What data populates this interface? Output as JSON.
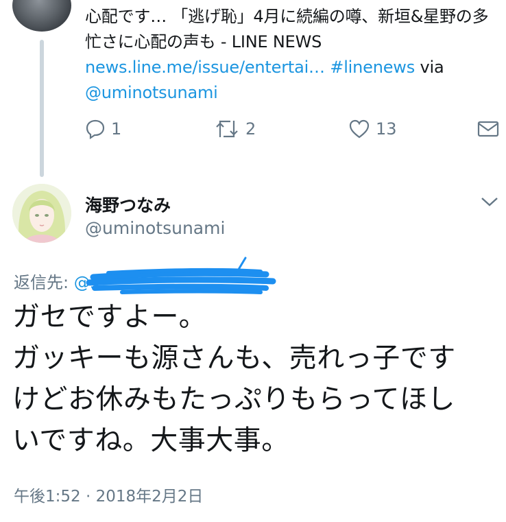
{
  "prev_tweet": {
    "text": "心配です… 「逃げ恥」4月に続編の噂、新垣&星野の多忙さに心配の声も  - LINE NEWS",
    "link_url": "news.line.me/issue/entertai…",
    "hashtag": "#linenews",
    "via_word": "via",
    "via_handle": "@uminotsunami",
    "actions": {
      "reply_count": "1",
      "retweet_count": "2",
      "like_count": "13"
    }
  },
  "tweet": {
    "display_name": "海野つなみ",
    "handle": "@uminotsunami",
    "reply_to_label": "返信先:",
    "reply_to_mention": "@s",
    "body": "ガセですよー。\nガッキーも源さんも、売れっ子です\nけどお休みもたっぷりもらってほし\nいですね。大事大事。",
    "timestamp": "午後1:52 · 2018年2月2日"
  },
  "icons": {
    "reply": "reply-icon",
    "retweet": "retweet-icon",
    "like": "heart-icon",
    "dm": "envelope-icon",
    "more": "chevron-down-icon"
  },
  "colors": {
    "link": "#1b95e0",
    "muted": "#657786",
    "thread_line": "#ccd6dd",
    "redaction": "#1d8ff0"
  }
}
